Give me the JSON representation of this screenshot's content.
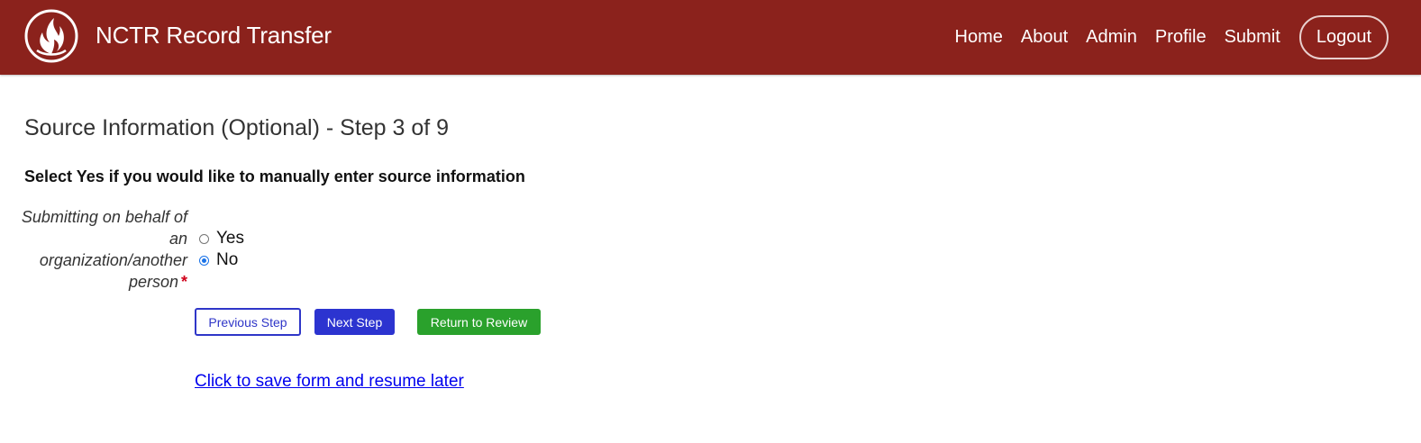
{
  "header": {
    "logo_icon": "flame-emblem-icon",
    "title": "NCTR Record Transfer",
    "background_color": "#8b221c",
    "nav": [
      {
        "label": "Home"
      },
      {
        "label": "About"
      },
      {
        "label": "Admin"
      },
      {
        "label": "Profile"
      },
      {
        "label": "Submit"
      }
    ],
    "logout_label": "Logout"
  },
  "main": {
    "page_title": "Source Information (Optional) - Step 3 of 9",
    "instructions": "Select Yes if you would like to manually enter source information",
    "field": {
      "label": "Submitting on behalf of an organization/another person",
      "required_marker": "*",
      "options": [
        {
          "label": "Yes",
          "checked": false
        },
        {
          "label": "No",
          "checked": true
        }
      ]
    },
    "buttons": {
      "previous": "Previous Step",
      "next": "Next Step",
      "review": "Return to Review"
    },
    "save_link": "Click to save form and resume later"
  }
}
